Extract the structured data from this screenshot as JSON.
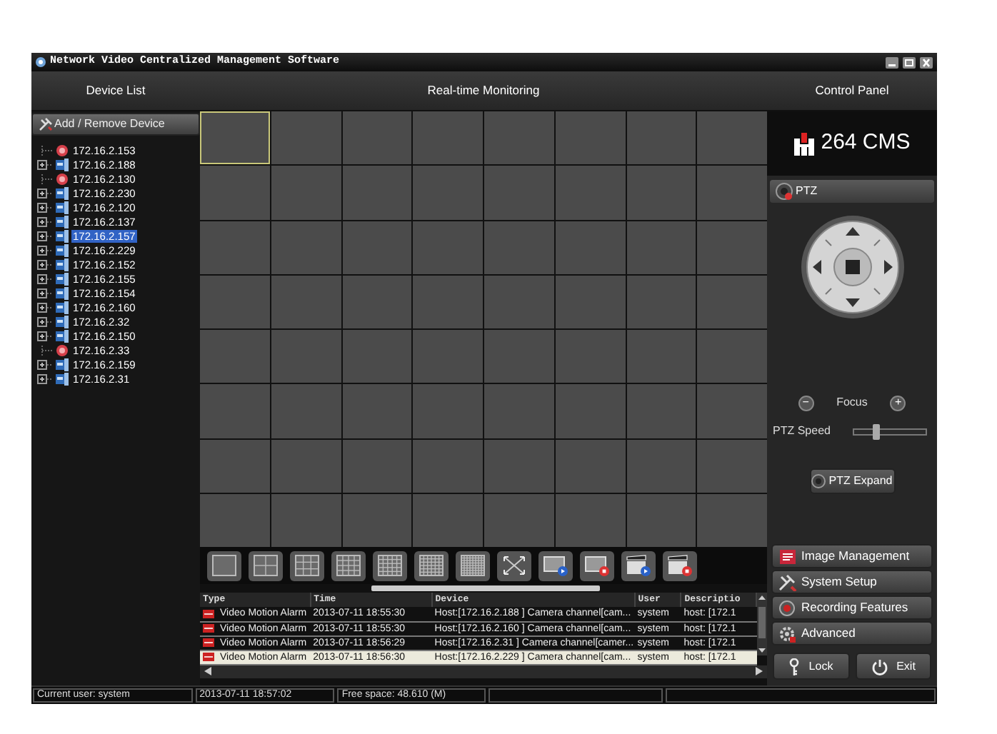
{
  "window": {
    "title": "Network Video Centralized Management Software"
  },
  "device_list": {
    "title": "Device List",
    "add_button": "Add / Remove Device",
    "items": [
      {
        "label": "172.16.2.153",
        "kind": "alarm",
        "expandable": false,
        "selected": false
      },
      {
        "label": "172.16.2.188",
        "kind": "camera",
        "expandable": true,
        "selected": false
      },
      {
        "label": "172.16.2.130",
        "kind": "alarm",
        "expandable": false,
        "selected": false
      },
      {
        "label": "172.16.2.230",
        "kind": "camera",
        "expandable": true,
        "selected": false
      },
      {
        "label": "172.16.2.120",
        "kind": "camera",
        "expandable": true,
        "selected": false
      },
      {
        "label": "172.16.2.137",
        "kind": "camera",
        "expandable": true,
        "selected": false
      },
      {
        "label": "172.16.2.157",
        "kind": "camera",
        "expandable": true,
        "selected": true
      },
      {
        "label": "172.16.2.229",
        "kind": "camera",
        "expandable": true,
        "selected": false
      },
      {
        "label": "172.16.2.152",
        "kind": "camera",
        "expandable": true,
        "selected": false
      },
      {
        "label": "172.16.2.155",
        "kind": "camera",
        "expandable": true,
        "selected": false
      },
      {
        "label": "172.16.2.154",
        "kind": "camera",
        "expandable": true,
        "selected": false
      },
      {
        "label": "172.16.2.160",
        "kind": "camera",
        "expandable": true,
        "selected": false
      },
      {
        "label": "172.16.2.32",
        "kind": "camera",
        "expandable": true,
        "selected": false
      },
      {
        "label": "172.16.2.150",
        "kind": "camera",
        "expandable": true,
        "selected": false
      },
      {
        "label": "172.16.2.33",
        "kind": "alarm",
        "expandable": false,
        "selected": false
      },
      {
        "label": "172.16.2.159",
        "kind": "camera",
        "expandable": true,
        "selected": false
      },
      {
        "label": "172.16.2.31",
        "kind": "camera",
        "expandable": true,
        "selected": false
      }
    ]
  },
  "monitoring": {
    "title": "Real-time Monitoring",
    "cells": [
      {
        "selected": true
      },
      {
        "selected": false
      },
      {
        "selected": false
      },
      {
        "selected": false
      },
      {
        "selected": false
      },
      {
        "selected": false
      },
      {
        "selected": false
      },
      {
        "selected": false
      },
      {
        "selected": false
      },
      {
        "selected": false
      },
      {
        "selected": false
      },
      {
        "selected": false
      },
      {
        "selected": false
      },
      {
        "selected": false
      },
      {
        "selected": false
      },
      {
        "selected": false
      },
      {
        "selected": false
      },
      {
        "selected": false
      },
      {
        "selected": false
      },
      {
        "selected": false
      },
      {
        "selected": false
      },
      {
        "selected": false
      },
      {
        "selected": false
      },
      {
        "selected": false
      },
      {
        "selected": false
      },
      {
        "selected": false
      },
      {
        "selected": false
      },
      {
        "selected": false
      },
      {
        "selected": false
      },
      {
        "selected": false
      },
      {
        "selected": false
      },
      {
        "selected": false
      },
      {
        "selected": false
      },
      {
        "selected": false
      },
      {
        "selected": false
      },
      {
        "selected": false
      },
      {
        "selected": false
      },
      {
        "selected": false
      },
      {
        "selected": false
      },
      {
        "selected": false
      },
      {
        "selected": false
      },
      {
        "selected": false
      },
      {
        "selected": false
      },
      {
        "selected": false
      },
      {
        "selected": false
      },
      {
        "selected": false
      },
      {
        "selected": false
      },
      {
        "selected": false
      },
      {
        "selected": false
      },
      {
        "selected": false
      },
      {
        "selected": false
      },
      {
        "selected": false
      },
      {
        "selected": false
      },
      {
        "selected": false
      },
      {
        "selected": false
      },
      {
        "selected": false
      },
      {
        "selected": false
      },
      {
        "selected": false
      },
      {
        "selected": false
      },
      {
        "selected": false
      },
      {
        "selected": false
      },
      {
        "selected": false
      },
      {
        "selected": false
      },
      {
        "selected": false
      }
    ]
  },
  "log": {
    "columns": [
      "Type",
      "Time",
      "Device",
      "User",
      "Descriptio"
    ],
    "rows": [
      {
        "type": "Video Motion Alarm",
        "time": "2013-07-11 18:55:30",
        "device": "Host:[172.16.2.188 ] Camera channel[cam...",
        "user": "system",
        "description": "host: [172.1",
        "selected": false
      },
      {
        "type": "Video Motion Alarm",
        "time": "2013-07-11 18:55:30",
        "device": "Host:[172.16.2.160 ] Camera channel[cam...",
        "user": "system",
        "description": "host: [172.1",
        "selected": false
      },
      {
        "type": "Video Motion Alarm",
        "time": "2013-07-11 18:56:29",
        "device": "Host:[172.16.2.31 ] Camera channel[camer...",
        "user": "system",
        "description": "host: [172.1",
        "selected": false
      },
      {
        "type": "Video Motion Alarm",
        "time": "2013-07-11 18:56:30",
        "device": "Host:[172.16.2.229 ] Camera channel[cam...",
        "user": "system",
        "description": "host: [172.1",
        "selected": true
      }
    ]
  },
  "control_panel": {
    "title": "Control Panel",
    "logo": "264 CMS",
    "ptz_label": "PTZ",
    "focus_label": "Focus",
    "focus_minus": "−",
    "focus_plus": "+",
    "speed_label": "PTZ Speed",
    "speed": {
      "level": 0.3
    },
    "expand_button": "PTZ Expand",
    "menu": [
      "Image Management",
      "System Setup",
      "Recording Features",
      "Advanced"
    ],
    "lock_button": "Lock",
    "exit_button": "Exit"
  },
  "status_bar": [
    "Current user: system",
    "2013-07-11 18:57:02",
    "Free space: 48.610 (M)"
  ]
}
